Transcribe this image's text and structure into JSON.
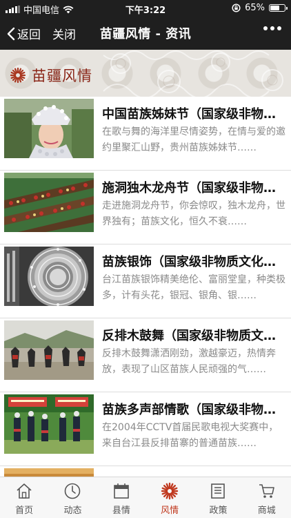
{
  "status_bar": {
    "carrier": "中国电信",
    "time": "下午3:22",
    "battery": "65%",
    "battery_level": 0.65
  },
  "nav": {
    "back_label": "返回",
    "close_label": "关闭",
    "title": "苗疆风情 - 资讯"
  },
  "section": {
    "title": "苗疆风情"
  },
  "news": [
    {
      "title": "中国苗族姊妹节（国家级非物质文化遗产）",
      "summary": "在歌与舞的海洋里尽情姿势，在情与爱的邀约里聚汇山野，贵州苗族姊妹节……",
      "image": "sisters-festival-photo"
    },
    {
      "title": "施洞独木龙舟节（国家级非物质文化遗产）",
      "summary": "走进施洞龙舟节，你会惊叹，独木龙舟，世界独有；苗族文化，恒久不衰……",
      "image": "dragon-boat-photo"
    },
    {
      "title": "苗族银饰（国家级非物质文化遗产）",
      "summary": "台江苗族银饰精美绝伦、富丽堂皇，种类极多，计有头花，银冠、银角、银……",
      "image": "silver-ornament-photo"
    },
    {
      "title": "反排木鼓舞（国家级非物质文化遗产）",
      "summary": "反排木鼓舞潇洒刚劲，激越豪迈，热情奔放，表现了山区苗族人民顽强的气……",
      "image": "drum-dance-photo"
    },
    {
      "title": "苗族多声部情歌（国家级非物质文化遗产）",
      "summary": "在2004年CCTV首届民歌电视大奖赛中，来自台江县反排苗寨的普通苗族……",
      "image": "love-song-photo"
    }
  ],
  "tabs": [
    {
      "label": "首页",
      "icon": "home-icon"
    },
    {
      "label": "动态",
      "icon": "clock-icon"
    },
    {
      "label": "县情",
      "icon": "calendar-icon"
    },
    {
      "label": "风情",
      "icon": "flower-icon",
      "active": true
    },
    {
      "label": "政策",
      "icon": "document-icon"
    },
    {
      "label": "商城",
      "icon": "cart-icon"
    }
  ],
  "colors": {
    "accent": "#c0391f",
    "section_title": "#8a2618",
    "bar_bg": "#1f1f1f"
  }
}
